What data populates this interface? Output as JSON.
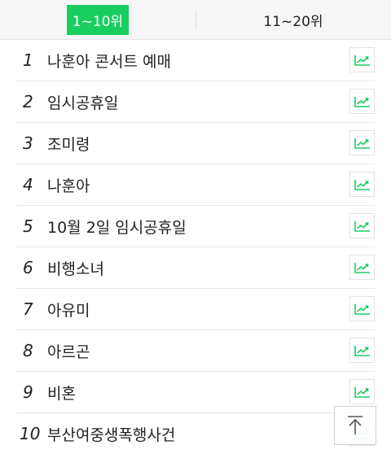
{
  "tabs": [
    {
      "label": "1~10위",
      "active": true
    },
    {
      "label": "11~20위",
      "active": false
    }
  ],
  "ranking": [
    {
      "rank": "1",
      "keyword": "나훈아 콘서트 예매"
    },
    {
      "rank": "2",
      "keyword": "임시공휴일"
    },
    {
      "rank": "3",
      "keyword": "조미령"
    },
    {
      "rank": "4",
      "keyword": "나훈아"
    },
    {
      "rank": "5",
      "keyword": "10월 2일 임시공휴일"
    },
    {
      "rank": "6",
      "keyword": "비행소녀"
    },
    {
      "rank": "7",
      "keyword": "아유미"
    },
    {
      "rank": "8",
      "keyword": "아르곤"
    },
    {
      "rank": "9",
      "keyword": "비혼"
    },
    {
      "rank": "10",
      "keyword": "부산여중생폭행사건"
    }
  ],
  "colors": {
    "accent": "#19ce60",
    "trend_icon": "#19ce60"
  },
  "icons": {
    "trend": "trend-chart-icon",
    "scroll_top": "arrow-up-to-top-icon"
  }
}
